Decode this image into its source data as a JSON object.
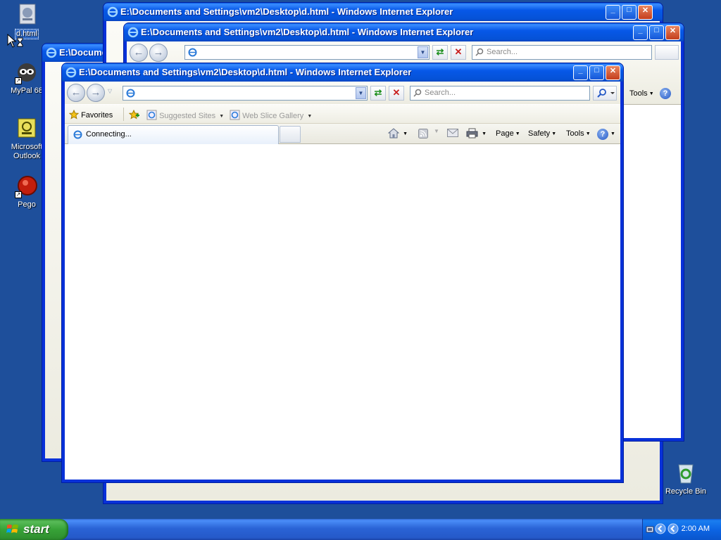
{
  "desktop": {
    "icons": [
      {
        "label": "d.html"
      },
      {
        "label": "MyPal 68"
      },
      {
        "label": "Microsoft Outlook"
      },
      {
        "label": "Pego"
      },
      {
        "label": "Recycle Bin"
      }
    ]
  },
  "windows": {
    "title": "E:\\Documents and Settings\\vm2\\Desktop\\d.html - Windows Internet Explorer",
    "title_partial": "E:\\Docume",
    "controls": {
      "minimize": "_",
      "maximize": "□",
      "close": "✕"
    },
    "toolbar": {
      "back_glyph": "←",
      "forward_glyph": "→",
      "address_value": "",
      "search_placeholder": "Search...",
      "refresh_glyph": "⇄",
      "stop_glyph": "✕"
    },
    "favorites": {
      "favorites_label": "Favorites",
      "suggested_sites": "Suggested Sites",
      "web_slice_gallery": "Web Slice Gallery"
    },
    "tab": {
      "label": "Connecting..."
    },
    "commands": {
      "page": "Page",
      "safety": "Safety",
      "tools": "Tools",
      "help": "?"
    }
  },
  "taskbar": {
    "start_label": "start",
    "clock": "2:00 AM"
  }
}
